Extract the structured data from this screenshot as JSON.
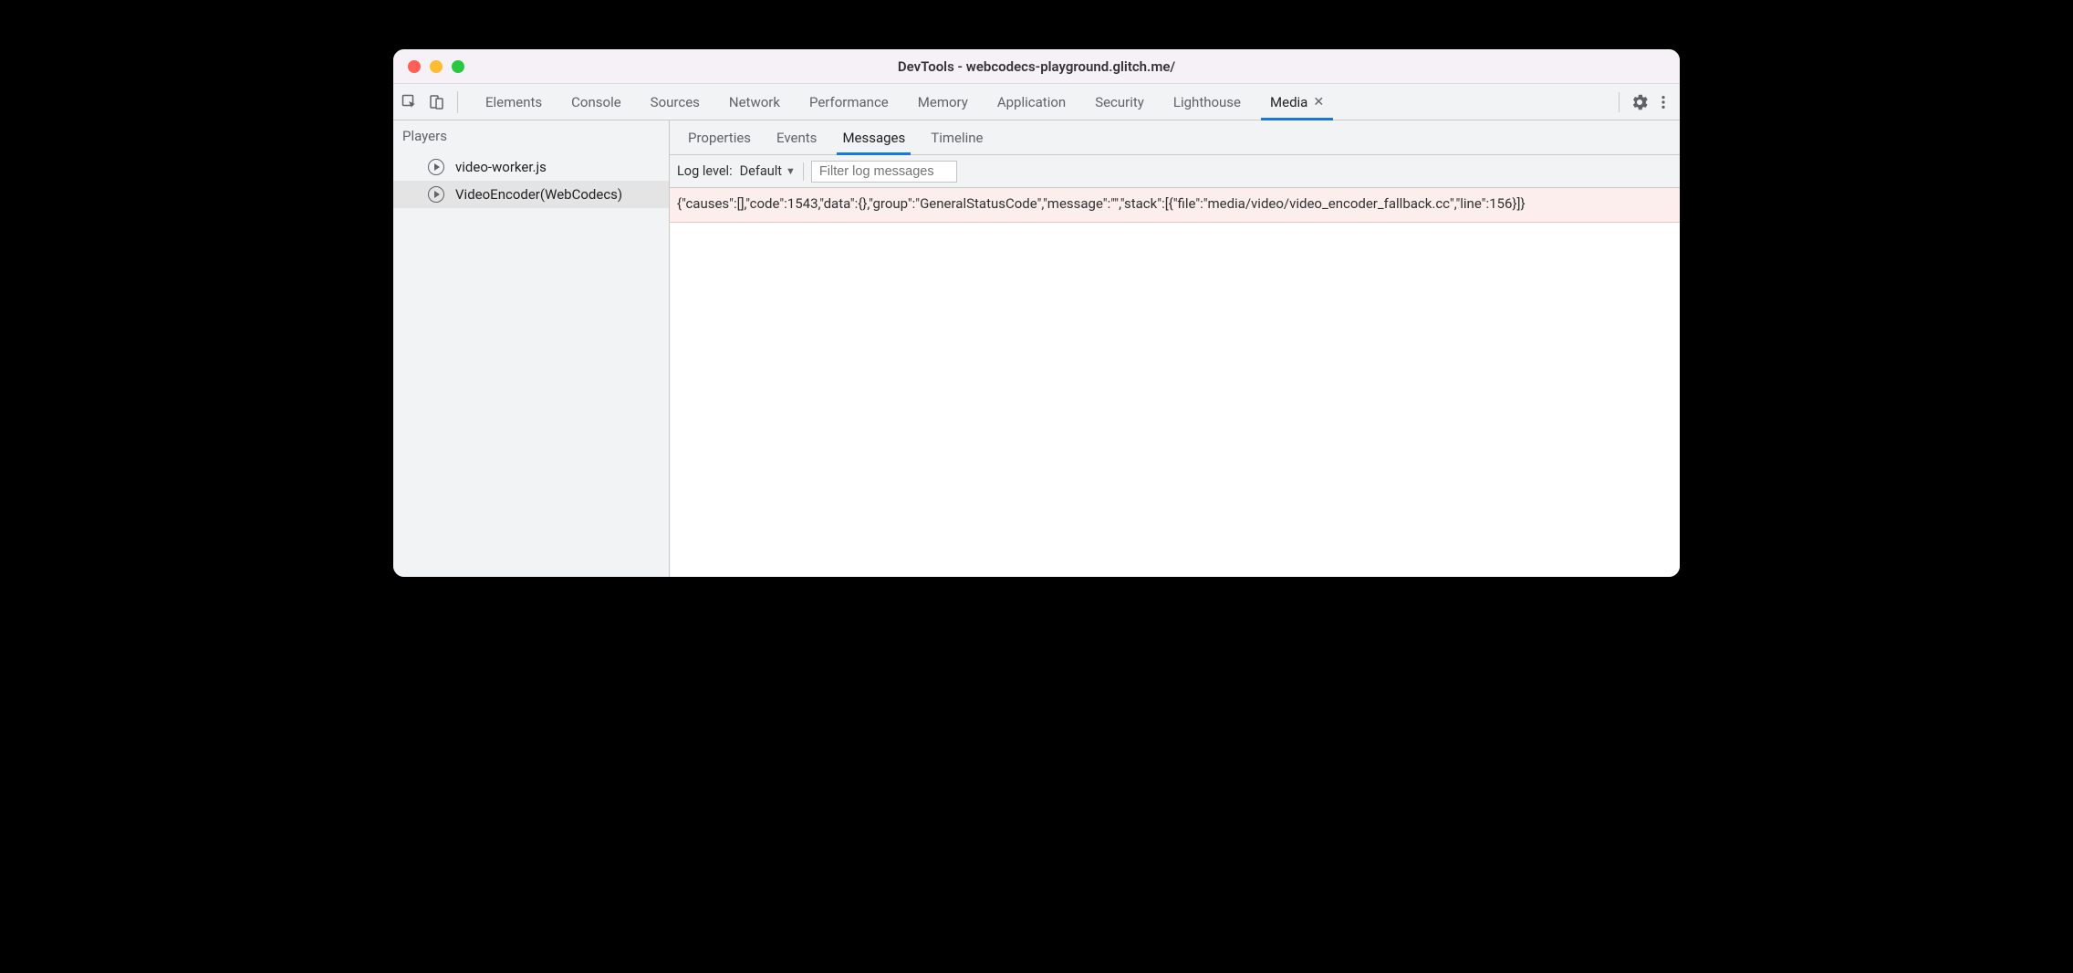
{
  "window": {
    "title": "DevTools - webcodecs-playground.glitch.me/"
  },
  "mainTabs": [
    {
      "label": "Elements"
    },
    {
      "label": "Console"
    },
    {
      "label": "Sources"
    },
    {
      "label": "Network"
    },
    {
      "label": "Performance"
    },
    {
      "label": "Memory"
    },
    {
      "label": "Application"
    },
    {
      "label": "Security"
    },
    {
      "label": "Lighthouse"
    },
    {
      "label": "Media",
      "active": true,
      "closable": true
    }
  ],
  "sidebar": {
    "title": "Players",
    "players": [
      {
        "label": "video-worker.js"
      },
      {
        "label": "VideoEncoder(WebCodecs)",
        "selected": true
      }
    ]
  },
  "subTabs": [
    {
      "label": "Properties"
    },
    {
      "label": "Events"
    },
    {
      "label": "Messages",
      "active": true
    },
    {
      "label": "Timeline"
    }
  ],
  "filterBar": {
    "logLevelLabel": "Log level:",
    "logLevelValue": "Default",
    "filterPlaceholder": "Filter log messages"
  },
  "logMessages": [
    {
      "text": "{\"causes\":[],\"code\":1543,\"data\":{},\"group\":\"GeneralStatusCode\",\"message\":\"\",\"stack\":[{\"file\":\"media/video/video_encoder_fallback.cc\",\"line\":156}]}",
      "level": "error"
    }
  ]
}
